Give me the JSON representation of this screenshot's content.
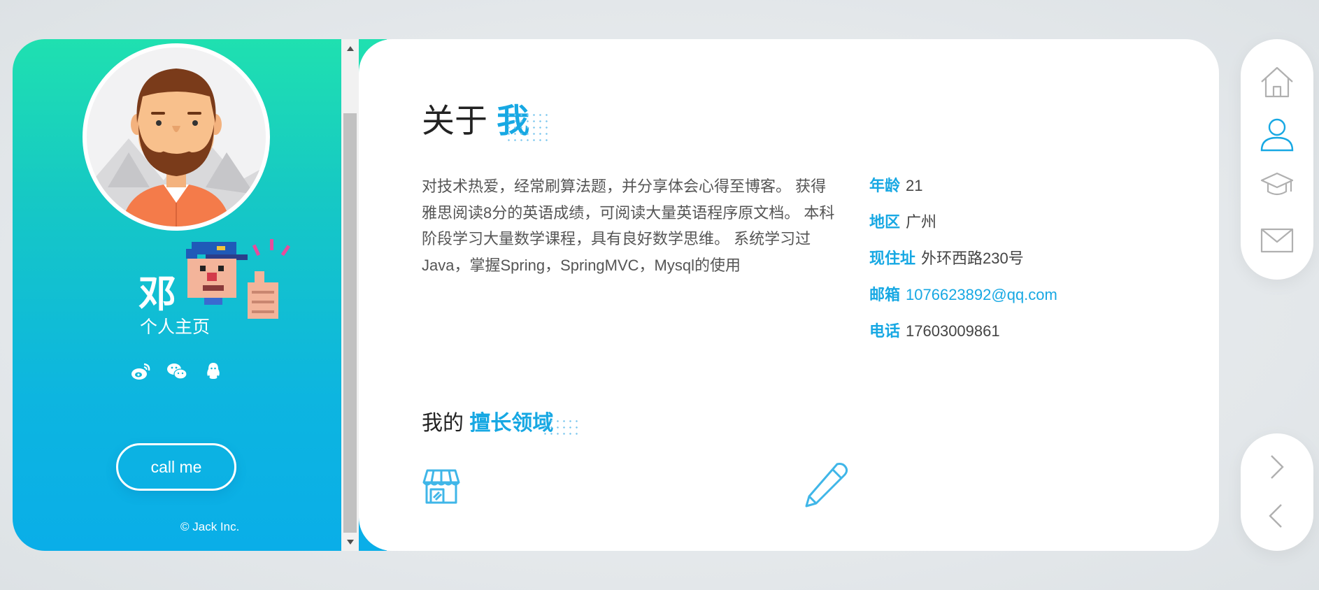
{
  "profile": {
    "name": "邓",
    "subtitle": "个人主页",
    "call_button": "call me",
    "copyright": "© Jack Inc."
  },
  "social_icons": [
    "weibo-icon",
    "wechat-icon",
    "qq-icon"
  ],
  "about": {
    "title_prefix": "关于",
    "title_highlight": "我",
    "description": "对技术热爱，经常刷算法题，并分享体会心得至博客。 获得雅思阅读8分的英语成绩，可阅读大量英语程序原文档。 本科阶段学习大量数学课程，具有良好数学思维。 系统学习过Java，掌握Spring，SpringMVC，Mysql的使用",
    "info": [
      {
        "label": "年龄",
        "value": "21"
      },
      {
        "label": "地区",
        "value": "广州"
      },
      {
        "label": "现住址",
        "value": "外环西路230号"
      },
      {
        "label": "邮箱",
        "value": "1076623892@qq.com"
      },
      {
        "label": "电话",
        "value": "17603009861"
      }
    ]
  },
  "skills": {
    "title_prefix": "我的",
    "title_highlight": "擅长领域",
    "icons": [
      "shop-icon",
      "pencil-icon"
    ]
  },
  "nav": {
    "items": [
      "home-icon",
      "user-icon",
      "graduation-cap-icon",
      "mail-icon"
    ],
    "active": "user-icon"
  },
  "pager": [
    "chevron-right-icon",
    "chevron-left-icon"
  ],
  "colors": {
    "accent": "#17a8e3",
    "gradient_top": "#1fe0b0",
    "gradient_bottom": "#0aaee8",
    "nav_icon": "#b0b0b0"
  }
}
